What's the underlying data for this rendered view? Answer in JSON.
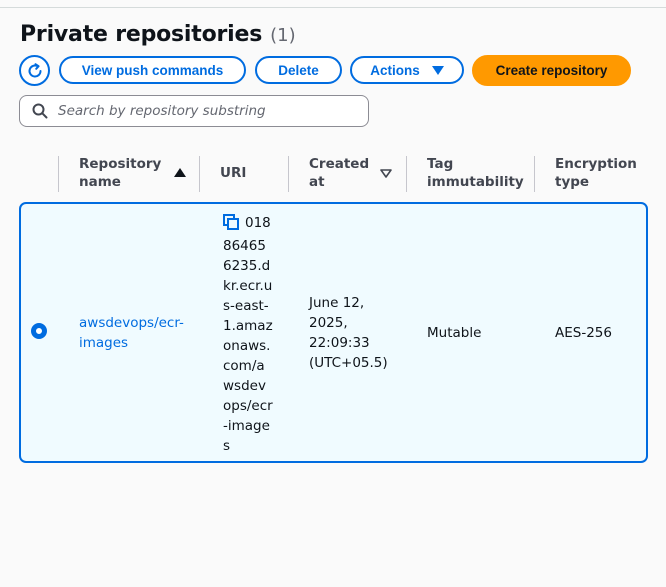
{
  "header": {
    "title": "Private repositories",
    "count": "(1)"
  },
  "toolbar": {
    "view_push_label": "View push commands",
    "delete_label": "Delete",
    "actions_label": "Actions",
    "create_label": "Create repository"
  },
  "search": {
    "placeholder": "Search by repository substring",
    "value": ""
  },
  "table": {
    "columns": {
      "name_line1": "Repository",
      "name_line2": "name",
      "uri": "URI",
      "created_line1": "Created",
      "created_line2": "at",
      "tag_line1": "Tag",
      "tag_line2": "immutability",
      "enc_line1": "Encryption",
      "enc_line2": "type"
    },
    "rows": [
      {
        "name_line1": "awsdevops/ecr-",
        "name_line2": "images",
        "uri_text": "018864656235.dkr.ecr.us-east-1.amazonaws.com/awsdevops/ecr-images",
        "created_line1": "June 12,",
        "created_line2": "2025,",
        "created_line3": "22:09:33",
        "created_line4": "(UTC+05.5)",
        "tag_immutability": "Mutable",
        "encryption": "AES-256"
      }
    ]
  },
  "colors": {
    "primary": "#006ce0",
    "create_button": "#ff9900",
    "selected_row_bg": "#f0fbff"
  },
  "icons": {
    "refresh": "refresh-icon",
    "search": "search-icon",
    "copy": "copy-icon",
    "sort_up": "sort-ascending-icon",
    "sort_down": "sort-descending-icon"
  }
}
